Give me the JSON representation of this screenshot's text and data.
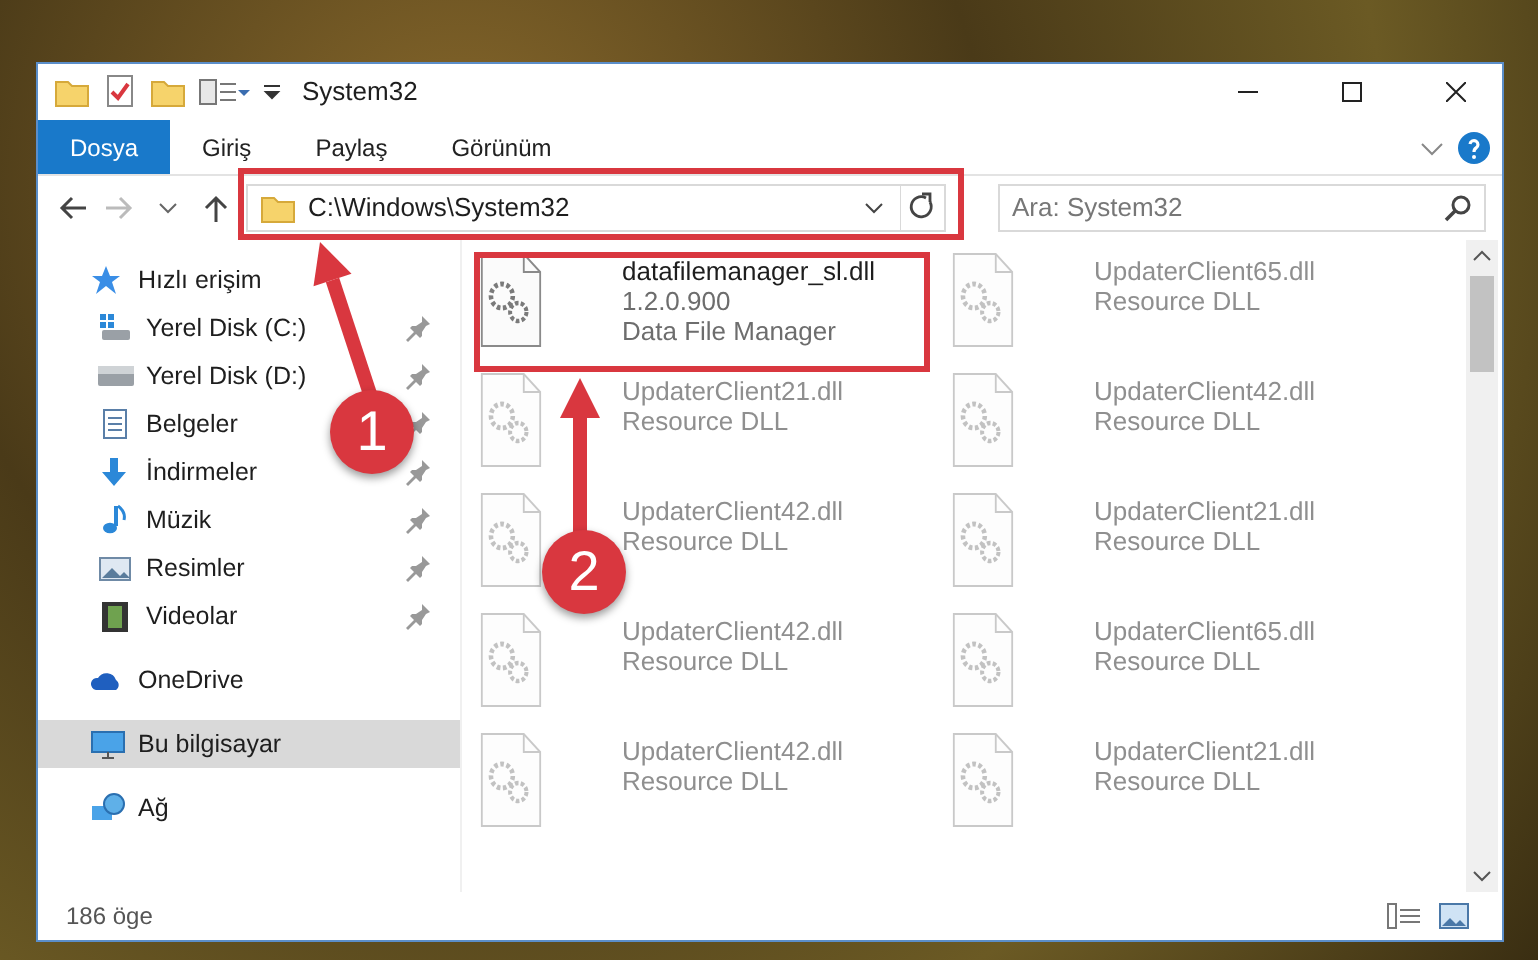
{
  "window": {
    "title": "System32"
  },
  "ribbon": {
    "tabs": [
      {
        "label": "Dosya",
        "selected": true
      },
      {
        "label": "Giriş",
        "selected": false
      },
      {
        "label": "Paylaş",
        "selected": false
      },
      {
        "label": "Görünüm",
        "selected": false
      }
    ]
  },
  "address_bar": {
    "path": "C:\\Windows\\System32"
  },
  "search": {
    "placeholder": "Ara: System32"
  },
  "sidebar": {
    "items": [
      {
        "label": "Hızlı erişim",
        "kind": "star",
        "selected": false,
        "children": [
          {
            "label": "Yerel Disk (C:)",
            "kind": "drive-c",
            "pinned": true,
            "selected": false
          },
          {
            "label": "Yerel Disk (D:)",
            "kind": "drive",
            "pinned": true,
            "selected": false
          },
          {
            "label": "Belgeler",
            "kind": "docs",
            "pinned": true,
            "selected": false
          },
          {
            "label": "İndirmeler",
            "kind": "download",
            "pinned": true,
            "selected": false
          },
          {
            "label": "Müzik",
            "kind": "music",
            "pinned": true,
            "selected": false
          },
          {
            "label": "Resimler",
            "kind": "pictures",
            "pinned": true,
            "selected": false
          },
          {
            "label": "Videolar",
            "kind": "videos",
            "pinned": true,
            "selected": false
          }
        ]
      },
      {
        "label": "OneDrive",
        "kind": "cloud",
        "selected": false
      },
      {
        "label": "Bu bilgisayar",
        "kind": "pc",
        "selected": true
      },
      {
        "label": "Ağ",
        "kind": "network",
        "selected": false
      }
    ]
  },
  "files": [
    {
      "name": "datafilemanager_sl.dll",
      "details": [
        "1.2.0.900",
        "Data File Manager"
      ],
      "faded": false
    },
    {
      "name": "UpdaterClient65.dll",
      "details": [
        "Resource DLL"
      ],
      "faded": true
    },
    {
      "name": "UpdaterClient21.dll",
      "details": [
        "Resource DLL"
      ],
      "faded": true
    },
    {
      "name": "UpdaterClient42.dll",
      "details": [
        "Resource DLL"
      ],
      "faded": true
    },
    {
      "name": "UpdaterClient42.dll",
      "details": [
        "Resource DLL"
      ],
      "faded": true
    },
    {
      "name": "UpdaterClient21.dll",
      "details": [
        "Resource DLL"
      ],
      "faded": true
    },
    {
      "name": "UpdaterClient42.dll",
      "details": [
        "Resource DLL"
      ],
      "faded": true
    },
    {
      "name": "UpdaterClient65.dll",
      "details": [
        "Resource DLL"
      ],
      "faded": true
    },
    {
      "name": "UpdaterClient42.dll",
      "details": [
        "Resource DLL"
      ],
      "faded": true
    },
    {
      "name": "UpdaterClient21.dll",
      "details": [
        "Resource DLL"
      ],
      "faded": true
    }
  ],
  "status_bar": {
    "item_count": "186 öge"
  },
  "annotations": [
    {
      "number": "1"
    },
    {
      "number": "2"
    }
  ]
}
